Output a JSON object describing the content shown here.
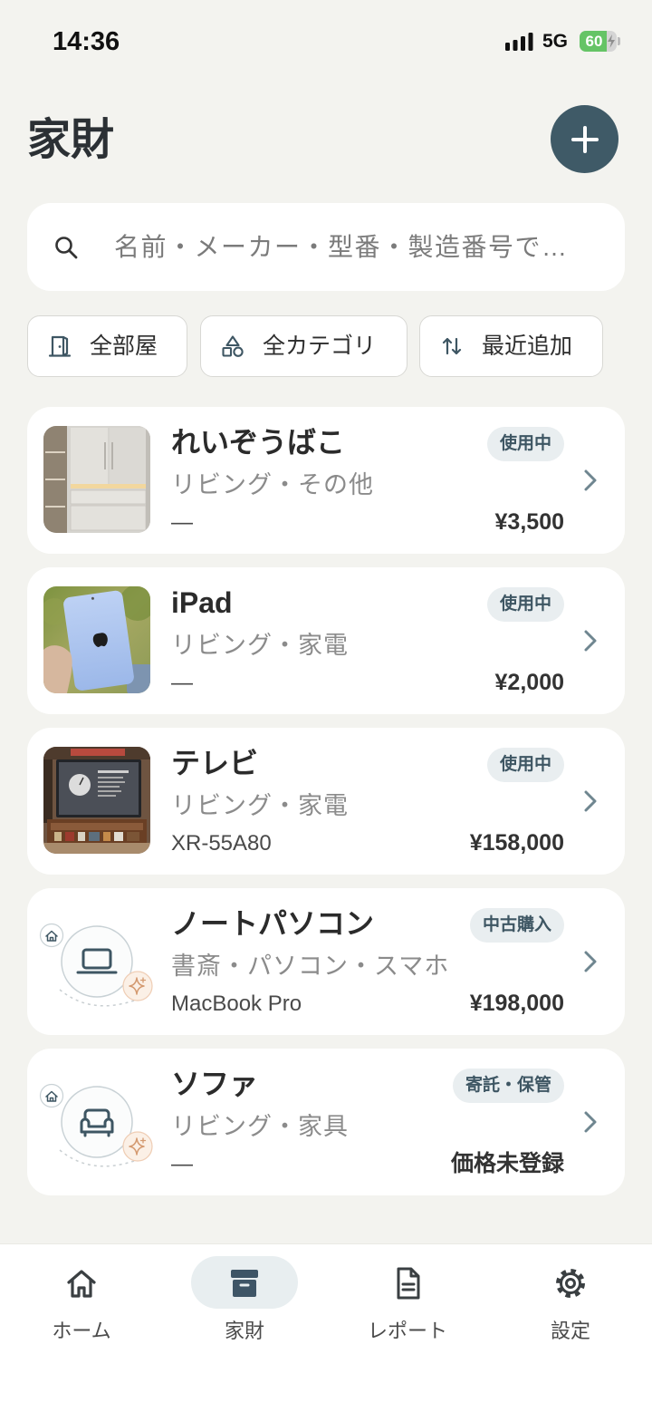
{
  "status_bar": {
    "time": "14:36",
    "network": "5G",
    "battery": "60",
    "icons": [
      "signal-icon",
      "battery-icon",
      "charging-bolt-icon"
    ]
  },
  "header": {
    "title": "家財",
    "add_button_icon": "plus-icon"
  },
  "search": {
    "placeholder": "名前・メーカー・型番・製造番号で…",
    "icon": "search-icon"
  },
  "filters": [
    {
      "label": "全部屋",
      "icon": "door-icon"
    },
    {
      "label": "全カテゴリ",
      "icon": "shapes-icon"
    },
    {
      "label": "最近追加",
      "icon": "sort-icon"
    }
  ],
  "items": [
    {
      "name": "れいぞうばこ",
      "status": "使用中",
      "location": "リビング・その他",
      "model": "—",
      "price": "¥3,500"
    },
    {
      "name": "iPad",
      "status": "使用中",
      "location": "リビング・家電",
      "model": "—",
      "price": "¥2,000"
    },
    {
      "name": "テレビ",
      "status": "使用中",
      "location": "リビング・家電",
      "model": "XR-55A80",
      "price": "¥158,000"
    },
    {
      "name": "ノートパソコン",
      "status": "中古購入",
      "location": "書斎・パソコン・スマホ",
      "model": "MacBook Pro",
      "price": "¥198,000",
      "placeholder_icon": "laptop-icon"
    },
    {
      "name": "ソファ",
      "status": "寄託・保管",
      "location": "リビング・家具",
      "model": "—",
      "price": "価格未登録",
      "placeholder_icon": "sofa-icon"
    }
  ],
  "tabs": [
    {
      "label": "ホーム",
      "icon": "home-icon",
      "active": false
    },
    {
      "label": "家財",
      "icon": "archive-box-icon",
      "active": true
    },
    {
      "label": "レポート",
      "icon": "document-icon",
      "active": false
    },
    {
      "label": "設定",
      "icon": "gear-icon",
      "active": false
    }
  ],
  "colors": {
    "background": "#f3f3ef",
    "accent": "#3f5a67",
    "badge_background": "#e9eef0",
    "badge_text": "#3e5663",
    "battery": "#65c466"
  }
}
